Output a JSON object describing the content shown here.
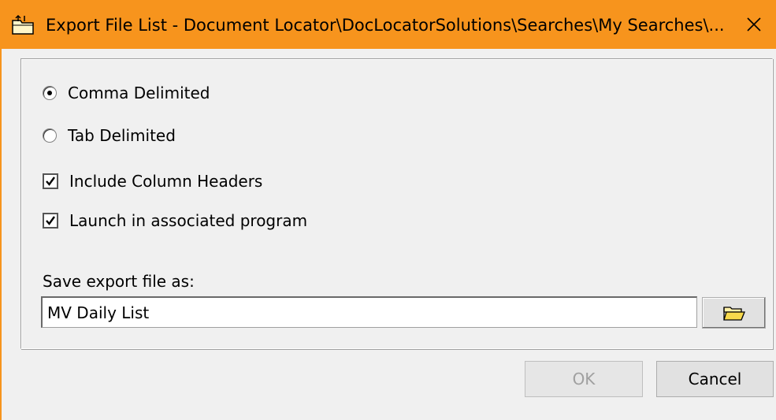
{
  "window": {
    "title": "Export File List - Document Locator\\DocLocatorSolutions\\Searches\\My Searches\\...",
    "title_icon": "export-folder-icon",
    "close_icon": "close-icon",
    "accent_color": "#f7941d"
  },
  "format": {
    "options": [
      {
        "label": "Comma Delimited",
        "selected": true
      },
      {
        "label": "Tab Delimited",
        "selected": false
      }
    ]
  },
  "checkboxes": [
    {
      "label": "Include Column Headers",
      "checked": true
    },
    {
      "label": "Launch in associated program",
      "checked": true
    }
  ],
  "save": {
    "label": "Save export file as:",
    "value": "MV Daily List",
    "browse_icon": "folder-icon"
  },
  "buttons": {
    "ok_label": "OK",
    "ok_enabled": false,
    "cancel_label": "Cancel"
  }
}
